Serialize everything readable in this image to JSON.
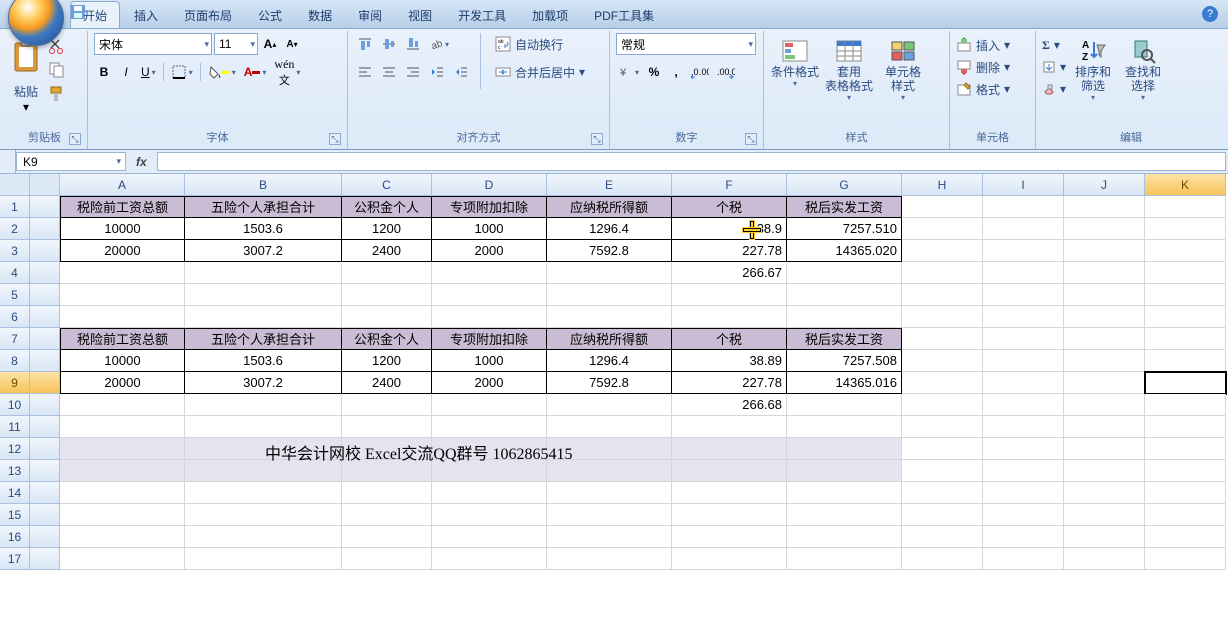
{
  "tabs": [
    "开始",
    "插入",
    "页面布局",
    "公式",
    "数据",
    "审阅",
    "视图",
    "开发工具",
    "加载项",
    "PDF工具集"
  ],
  "activeTab": 0,
  "ribbon": {
    "clipboard": {
      "paste": "粘贴",
      "label": "剪贴板"
    },
    "font": {
      "name": "宋体",
      "size": "11",
      "label": "字体"
    },
    "alignment": {
      "wrap": "自动换行",
      "merge": "合并后居中",
      "label": "对齐方式"
    },
    "number": {
      "format": "常规",
      "label": "数字"
    },
    "styles": {
      "cond": "条件格式",
      "table": "套用\n表格格式",
      "cell": "单元格\n样式",
      "label": "样式"
    },
    "cells": {
      "insert": "插入",
      "delete": "删除",
      "format": "格式",
      "label": "单元格"
    },
    "editing": {
      "sort": "排序和\n筛选",
      "find": "查找和\n选择",
      "label": "编辑"
    }
  },
  "nameBox": "K9",
  "formula": "",
  "columns": [
    "A",
    "B",
    "C",
    "D",
    "E",
    "F",
    "G",
    "H",
    "I",
    "J",
    "K"
  ],
  "rows": [
    "1",
    "2",
    "3",
    "4",
    "5",
    "6",
    "7",
    "8",
    "9",
    "10",
    "11",
    "12",
    "13",
    "14",
    "15",
    "16",
    "17"
  ],
  "activeCell": "K9",
  "cursorCell": "F2",
  "headers": [
    "税险前工资总额",
    "五险个人承担合计",
    "公积金个人",
    "专项附加扣除",
    "应纳税所得额",
    "个税",
    "税后实发工资"
  ],
  "table1": [
    [
      "10000",
      "1503.6",
      "1200",
      "1000",
      "1296.4",
      "38.9",
      "7257.510"
    ],
    [
      "20000",
      "3007.2",
      "2400",
      "2000",
      "7592.8",
      "227.78",
      "14365.020"
    ]
  ],
  "table1_extra_F4": "266.67",
  "table2": [
    [
      "10000",
      "1503.6",
      "1200",
      "1000",
      "1296.4",
      "38.89",
      "7257.508"
    ],
    [
      "20000",
      "3007.2",
      "2400",
      "2000",
      "7592.8",
      "227.78",
      "14365.016"
    ]
  ],
  "table2_extra_F10": "266.68",
  "banner": "中华会计网校 Excel交流QQ群号 1062865415"
}
